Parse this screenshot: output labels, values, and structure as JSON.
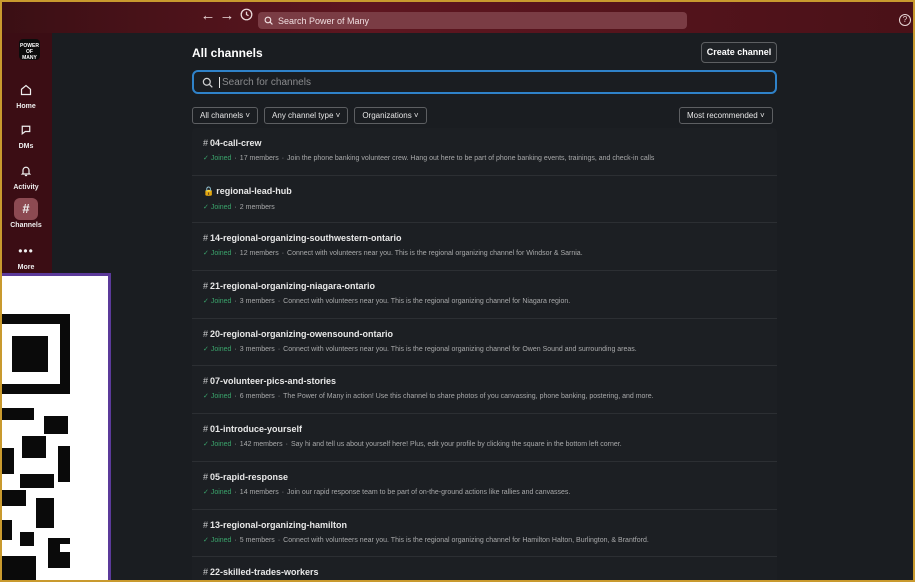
{
  "topbar": {
    "back_icon": "arrow-left-icon",
    "forward_icon": "arrow-right-icon",
    "history_icon": "clock-icon",
    "search_placeholder": "Search Power of Many",
    "help_icon": "help-icon"
  },
  "sidebar": {
    "logo_text": "POWER OF MANY",
    "items": [
      {
        "label": "Home",
        "icon": "home-icon"
      },
      {
        "label": "DMs",
        "icon": "dm-icon"
      },
      {
        "label": "Activity",
        "icon": "bell-icon"
      },
      {
        "label": "Channels",
        "icon": "hash-icon"
      },
      {
        "label": "More",
        "icon": "more-icon"
      }
    ]
  },
  "main": {
    "title": "All channels",
    "create_button": "Create channel",
    "search_placeholder": "Search for channels",
    "filters": [
      "All channels",
      "Any channel type",
      "Organizations"
    ],
    "sort": "Most recommended"
  },
  "channels": [
    {
      "prefix": "#",
      "name": "04-call-crew",
      "status": "Joined",
      "members": "17 members",
      "desc": "Join the phone banking volunteer crew. Hang out here to be part of phone banking events, trainings, and check-in calls"
    },
    {
      "prefix": "🔒",
      "name": "regional-lead-hub",
      "status": "Joined",
      "members": "2 members",
      "desc": ""
    },
    {
      "prefix": "#",
      "name": "14-regional-organizing-southwestern-ontario",
      "status": "Joined",
      "members": "12 members",
      "desc": "Connect with volunteers near you. This is the regional organizing channel for Windsor & Sarnia."
    },
    {
      "prefix": "#",
      "name": "21-regional-organizing-niagara-ontario",
      "status": "Joined",
      "members": "3 members",
      "desc": "Connect with volunteers near you. This is the regional organizing channel for Niagara region."
    },
    {
      "prefix": "#",
      "name": "20-regional-organizing-owensound-ontario",
      "status": "Joined",
      "members": "3 members",
      "desc": "Connect with volunteers near you. This is the regional organizing channel for Owen Sound and surrounding areas."
    },
    {
      "prefix": "#",
      "name": "07-volunteer-pics-and-stories",
      "status": "Joined",
      "members": "6 members",
      "desc": "The Power of Many in action! Use this channel to share photos of you canvassing, phone banking, postering, and more."
    },
    {
      "prefix": "#",
      "name": "01-introduce-yourself",
      "status": "Joined",
      "members": "142 members",
      "desc": "Say hi and tell us about yourself here! Plus, edit your profile by clicking the square in the bottom left corner."
    },
    {
      "prefix": "#",
      "name": "05-rapid-response",
      "status": "Joined",
      "members": "14 members",
      "desc": "Join our rapid response team to be part of on-the-ground actions like rallies and canvasses."
    },
    {
      "prefix": "#",
      "name": "13-regional-organizing-hamilton",
      "status": "Joined",
      "members": "5 members",
      "desc": "Connect with volunteers near you. This is the regional organizing channel for Hamilton Halton, Burlington, & Brantford."
    },
    {
      "prefix": "#",
      "name": "22-skilled-trades-workers",
      "status": "",
      "members": "",
      "desc": ""
    }
  ]
}
